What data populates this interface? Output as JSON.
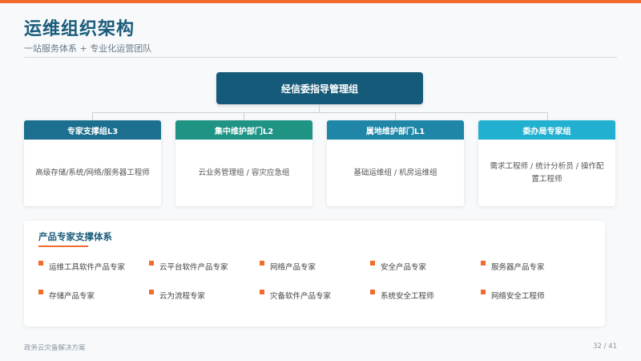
{
  "header": {
    "title": "运维组织架构",
    "subtitle": "一站服务体系 + 专业化运营团队"
  },
  "org": {
    "root": "经信委指导管理组",
    "departments": [
      {
        "name": "专家支撑组L3",
        "desc": "高级存储/系统/网络/服务器工程师",
        "color": "#1c6f8e"
      },
      {
        "name": "集中维护部门L2",
        "desc": "云业务管理组 / 容灾应急组",
        "color": "#1f9384"
      },
      {
        "name": "属地维护部门L1",
        "desc": "基础运维组 / 机房运维组",
        "color": "#1f86a8"
      },
      {
        "name": "委办局专家组",
        "desc": "需求工程师 / 统计分析员 / 操作配置工程师",
        "color": "#22b0d0"
      }
    ]
  },
  "support": {
    "title": "产品专家支撑体系",
    "experts": [
      "运维工具软件产品专家",
      "云平台软件产品专家",
      "网络产品专家",
      "安全产品专家",
      "服务器产品专家",
      "存储产品专家",
      "云为流程专家",
      "灾备软件产品专家",
      "系统安全工程师",
      "网络安全工程师"
    ]
  },
  "footer": {
    "left": "政务云灾备解决方案",
    "page": "32 / 41"
  },
  "colors": {
    "accent": "#f26b2c",
    "primary": "#155a78"
  }
}
